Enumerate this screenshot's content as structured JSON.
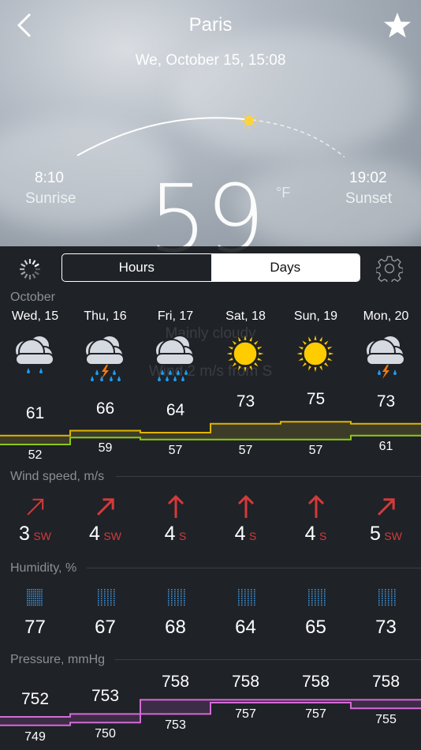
{
  "header": {
    "city": "Paris",
    "datetime": "We, October 15, 15:08",
    "back_icon": "chevron-left-icon",
    "favorite_icon": "star-icon"
  },
  "sun": {
    "sunrise_time": "8:10",
    "sunrise_label": "Sunrise",
    "sunset_time": "19:02",
    "sunset_label": "Sunset"
  },
  "current": {
    "temperature": "59",
    "unit": "°F",
    "condition": "Mainly cloudy",
    "wind": "Wind 2 m/s from S"
  },
  "toolbar": {
    "tabs": [
      {
        "label": "Hours",
        "selected": false
      },
      {
        "label": "Days",
        "selected": true
      }
    ],
    "settings_icon": "gear-icon",
    "loading_icon": "spinner-icon"
  },
  "month": "October",
  "days": [
    {
      "label": "Wed, 15",
      "icon": "cloud-rain",
      "high": 61,
      "low": 52,
      "wind": "3",
      "dir": "SW",
      "humidity": "77",
      "p_high": 752,
      "p_low": 749
    },
    {
      "label": "Thu, 16",
      "icon": "cloud-thunderstorm",
      "high": 66,
      "low": 59,
      "wind": "4",
      "dir": "SW",
      "humidity": "67",
      "p_high": 753,
      "p_low": 750
    },
    {
      "label": "Fri, 17",
      "icon": "cloud-heavy-rain",
      "high": 64,
      "low": 57,
      "wind": "4",
      "dir": "S",
      "humidity": "68",
      "p_high": 758,
      "p_low": 753
    },
    {
      "label": "Sat, 18",
      "icon": "sun",
      "high": 73,
      "low": 57,
      "wind": "4",
      "dir": "S",
      "humidity": "64",
      "p_high": 758,
      "p_low": 757
    },
    {
      "label": "Sun, 19",
      "icon": "sun",
      "high": 75,
      "low": 57,
      "wind": "4",
      "dir": "S",
      "humidity": "65",
      "p_high": 758,
      "p_low": 757
    },
    {
      "label": "Mon, 20",
      "icon": "cloud-thunderstorm",
      "high": 73,
      "low": 61,
      "wind": "5",
      "dir": "SW",
      "humidity": "73",
      "p_high": 758,
      "p_low": 755
    }
  ],
  "sections": {
    "wind": "Wind speed, m/s",
    "humidity": "Humidity, %",
    "pressure": "Pressure, mmHg"
  },
  "colors": {
    "temp_high": "#e0b400",
    "temp_low": "#8cc919",
    "pressure": "#d46ad8",
    "wind_arrow": "#d43a3a",
    "humidity": "#3f8fd0",
    "background": "#1f2227"
  }
}
